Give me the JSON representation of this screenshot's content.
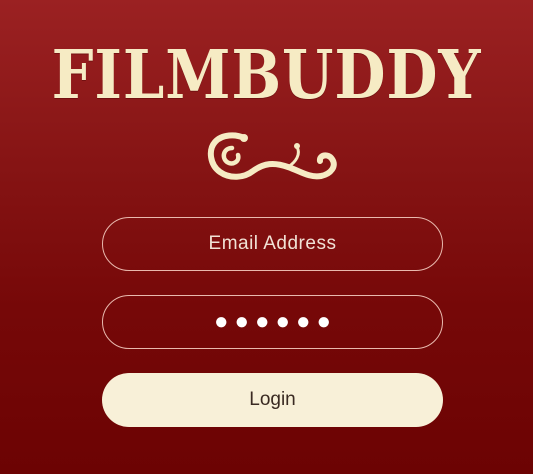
{
  "app": {
    "title": "FILMBUDDY",
    "ornament_icon": "swirl-flourish-icon",
    "colors": {
      "background_top": "#9b2122",
      "background_bottom": "#6c0303",
      "cream": "#f6ebc4",
      "field_border": "#e9b9ae",
      "button_text": "#3a2a22"
    }
  },
  "login": {
    "email_placeholder": "Email Address",
    "email_value": "",
    "password_mask": "●●●●●●",
    "button_label": "Login"
  }
}
